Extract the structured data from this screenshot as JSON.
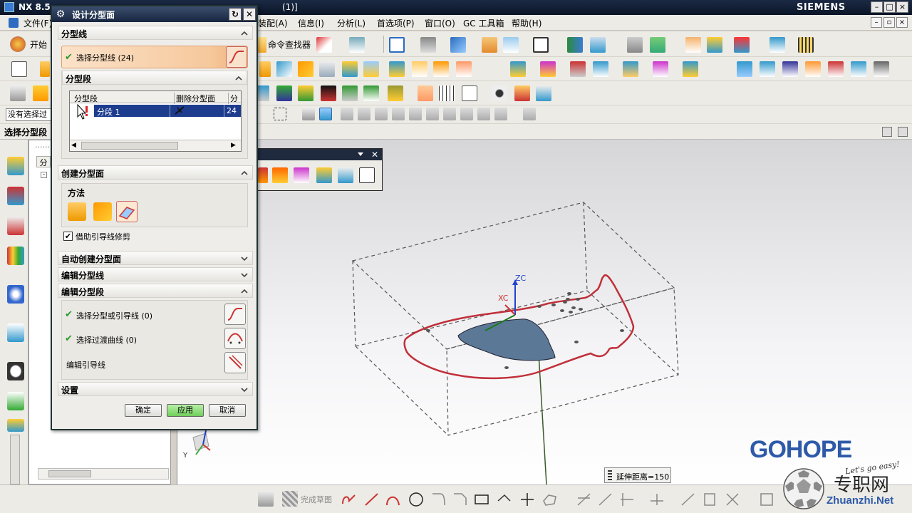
{
  "titlebar": {
    "app": "NX 8.5",
    "tail": "(1)]",
    "brand": "SIEMENS"
  },
  "menu": {
    "file": "文件(F)",
    "items": [
      "装配(A)",
      "信息(I)",
      "分析(L)",
      "首选项(P)",
      "窗口(O)",
      "GC 工具箱",
      "帮助(H)"
    ]
  },
  "toolbar": {
    "start": "开始",
    "command_finder": "命令查找器"
  },
  "selection_bar": {
    "filter_text": "没有选择过",
    "prompt": "选择分型段"
  },
  "navigator": {
    "header": "分",
    "dots": "......"
  },
  "dialog": {
    "title": "设计分型面",
    "section_parting_line": "分型线",
    "select_parting_line": "选择分型线 (24)",
    "section_segments": "分型段",
    "table_headers": [
      "分型段",
      "删除分型面",
      "分"
    ],
    "table_row": {
      "name": "分段 1",
      "count": "24"
    },
    "section_create": "创建分型面",
    "method_label": "方法",
    "guide_trim_label": "借助引导线修剪",
    "guide_trim_checked": true,
    "section_auto_create": "自动创建分型面",
    "section_edit_line": "编辑分型线",
    "section_edit_segment": "编辑分型段",
    "select_parting_or_guide": "选择分型或引导线 (0)",
    "select_transition_curve": "选择过渡曲线 (0)",
    "edit_guide": "编辑引导线",
    "section_settings": "设置",
    "ok": "确定",
    "apply": "应用",
    "cancel": "取消"
  },
  "viewport": {
    "zc_label": "ZC",
    "xc_label": "XC",
    "y_label": "Y",
    "status": "延伸距离=150"
  },
  "bottom": {
    "finish_sketch": "完成草图"
  },
  "watermark": {
    "brand": "GOHOPE",
    "slogan": "Let's go easy!",
    "site_cn": "专职网",
    "site_url": "Zhuanzhi.Net"
  },
  "colors": {
    "parting_line": "#c0303a",
    "surface_fill": "#5b7896",
    "dialog_title": "#1d2c48"
  }
}
